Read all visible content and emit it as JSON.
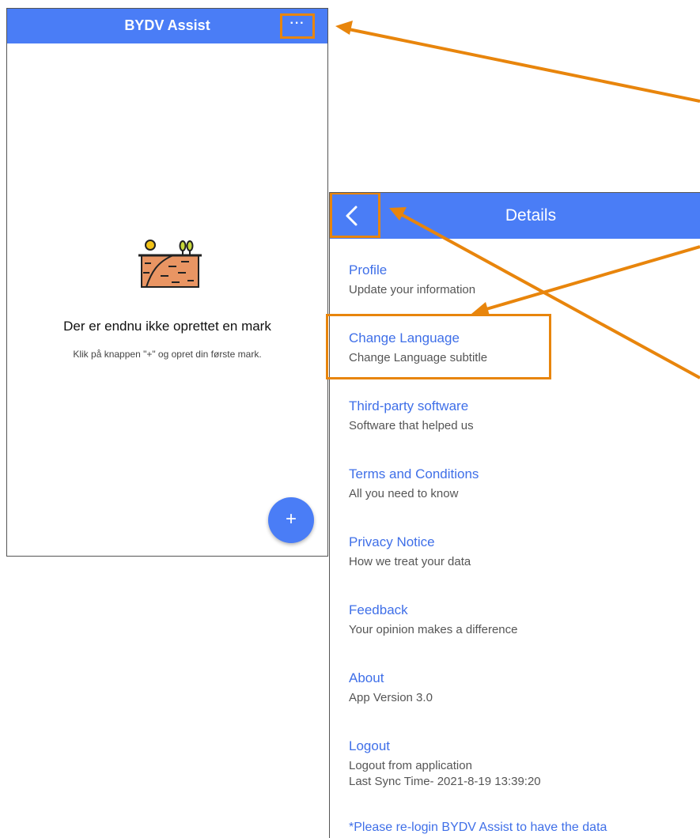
{
  "left_screen": {
    "title": "BYDV Assist",
    "more_label": "···",
    "empty_title": "Der er endnu ikke oprettet en mark",
    "empty_subtitle": "Klik på knappen \"+\" og opret din første mark.",
    "fab_label": "+",
    "icon": "field-soil-icon"
  },
  "right_screen": {
    "title": "Details",
    "back_icon": "chevron-left-icon",
    "menu": [
      {
        "title": "Profile",
        "subtitle": "Update your information"
      },
      {
        "title": "Change Language",
        "subtitle": "Change Language subtitle"
      },
      {
        "title": "Third-party software",
        "subtitle": "Software that helped us"
      },
      {
        "title": "Terms and Conditions",
        "subtitle": "All you need to know"
      },
      {
        "title": "Privacy Notice",
        "subtitle": "How we treat your data"
      },
      {
        "title": "Feedback",
        "subtitle": "Your opinion makes a difference"
      },
      {
        "title": "About",
        "subtitle": "App Version 3.0"
      },
      {
        "title": "Logout",
        "subtitle": "Logout from application",
        "sync": "Last Sync Time- 2021-8-19 13:39:20"
      }
    ],
    "note": "*Please re-login BYDV Assist to have the data"
  },
  "colors": {
    "header_blue": "#4a7df6",
    "link_blue": "#3f6fe8",
    "annotation_orange": "#e8850c"
  }
}
